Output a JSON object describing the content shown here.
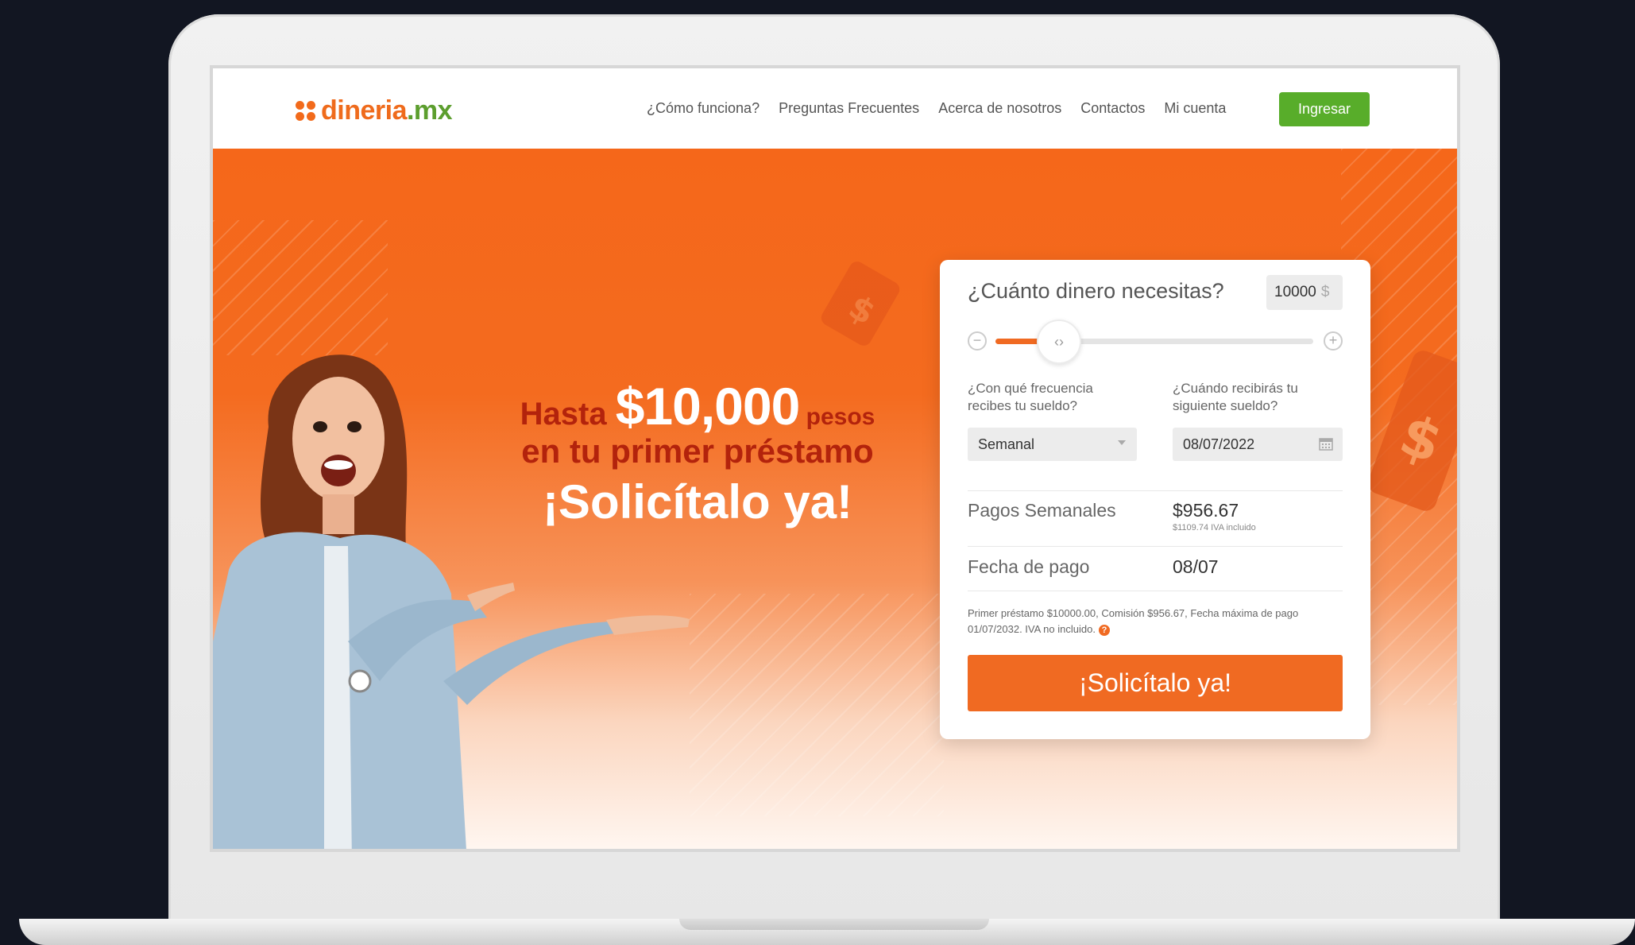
{
  "brand": {
    "logo_part1": "dineria",
    "logo_part2": ".mx",
    "colors": {
      "orange": "#f06a22",
      "green": "#58ad2a",
      "dark_red": "#b3230c"
    }
  },
  "nav": {
    "links": [
      "¿Cómo funciona?",
      "Preguntas Frecuentes",
      "Acerca de nosotros",
      "Contactos",
      "Mi cuenta"
    ],
    "login_label": "Ingresar"
  },
  "hero": {
    "line1_prefix": "Hasta ",
    "line1_amount": "$10,000",
    "line1_suffix": " pesos",
    "line2": "en tu primer préstamo",
    "line3": "¡Solicítalo ya!"
  },
  "calculator": {
    "question": "¿Cuánto dinero necesitas?",
    "amount_value": "10000",
    "amount_currency": "$",
    "slider_fraction": 0.2,
    "minus_glyph": "−",
    "plus_glyph": "+",
    "handle_glyph": "‹›",
    "frequency_label": "¿Con qué frecuencia recibes tu sueldo?",
    "frequency_value": "Semanal",
    "next_pay_label": "¿Cuándo recibirás tu siguiente sueldo?",
    "next_pay_value": "08/07/2022",
    "payments_label": "Pagos Semanales",
    "payments_value": "$956.67",
    "payments_sub": "$1109.74 IVA incluido",
    "due_label": "Fecha de pago",
    "due_value": "08/07",
    "fine_print": "Primer préstamo $10000.00, Comisión $956.67, Fecha máxima de pago 01/07/2032. IVA no incluido.",
    "help_glyph": "?",
    "cta_label": "¡Solicítalo ya!"
  },
  "carousel": {
    "active_index": 0
  }
}
